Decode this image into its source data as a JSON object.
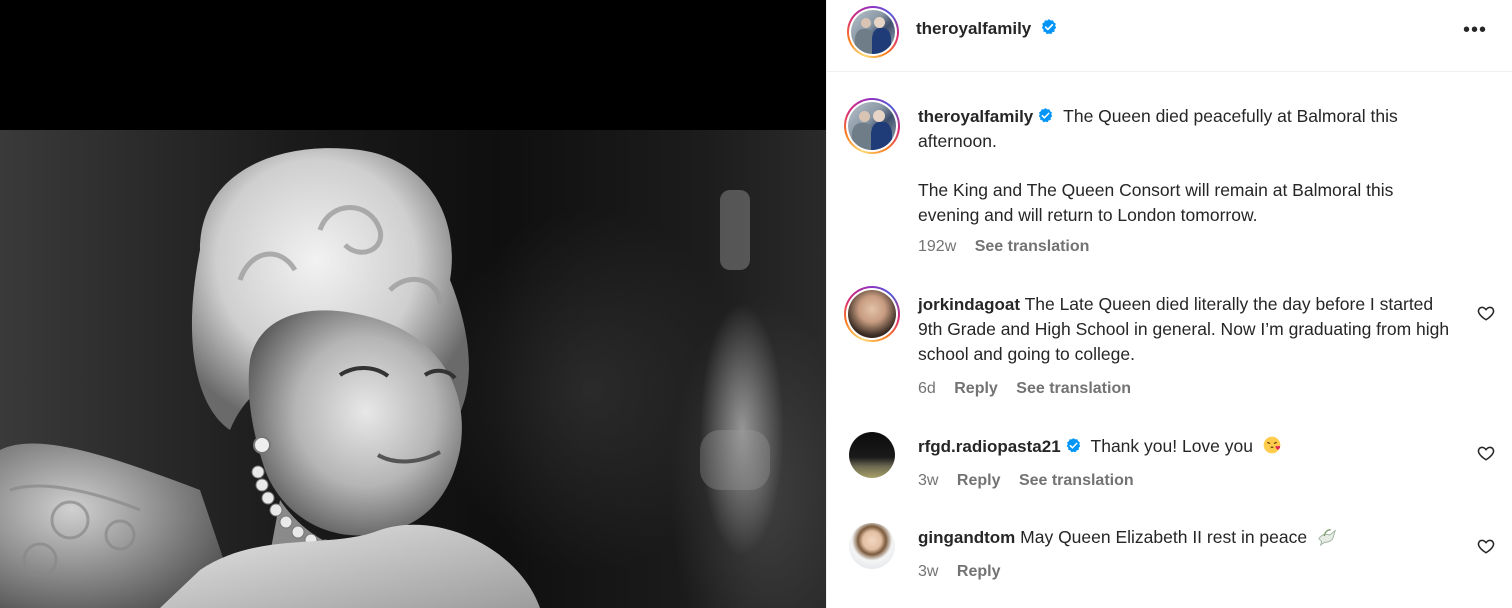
{
  "post": {
    "username": "theroyalfamily",
    "more_label": "•••"
  },
  "caption": {
    "username": "theroyalfamily",
    "line1": "The Queen died peacefully at Balmoral this afternoon.",
    "line2": "The King and The Queen Consort will remain at Balmoral this evening and will return to London tomorrow.",
    "time": "192w",
    "see_translation": "See translation"
  },
  "comments": [
    {
      "username": "jorkindagoat",
      "text": "The Late Queen died literally the day before I started 9th Grade and High School in general. Now I’m graduating from high school and going to college.",
      "time": "6d",
      "reply": "Reply",
      "see_translation": "See translation"
    },
    {
      "username": "rfgd.radiopasta21",
      "text": "Thank you! Love you",
      "emoji": "face-blowing-kiss",
      "time": "3w",
      "reply": "Reply",
      "see_translation": "See translation"
    },
    {
      "username": "gingandtom",
      "text": "May Queen Elizabeth II rest in peace",
      "emoji": "dove",
      "time": "3w",
      "reply": "Reply"
    }
  ],
  "colors": {
    "verified": "#0095f6",
    "meta": "#737373",
    "text": "#262626"
  }
}
